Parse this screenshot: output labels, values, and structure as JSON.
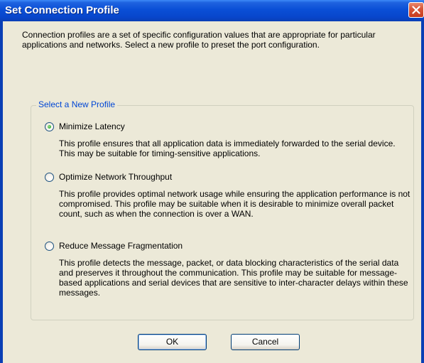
{
  "window": {
    "title": "Set Connection Profile",
    "close_icon": "close-icon"
  },
  "intro_text": "Connection profiles are a set of specific configuration values that are appropriate for particular applications and networks.  Select a new profile to preset the port configuration.",
  "group": {
    "legend": "Select a New Profile",
    "selected": "minimize-latency",
    "options": [
      {
        "id": "minimize-latency",
        "label": "Minimize Latency",
        "checked": true,
        "description": "This profile ensures that all application data is immediately forwarded to the serial device. This may be suitable for timing-sensitive applications."
      },
      {
        "id": "optimize-throughput",
        "label": "Optimize Network Throughput",
        "checked": false,
        "description": "This profile provides optimal network usage while ensuring the application performance is not compromised. This profile may be suitable when it is desirable to minimize overall packet count, such as when the connection is over a WAN."
      },
      {
        "id": "reduce-fragmentation",
        "label": "Reduce Message Fragmentation",
        "checked": false,
        "description": "This profile detects the message, packet, or data blocking characteristics of the serial data and preserves it throughout the communication. This profile may be suitable for message-based applications and serial devices that are sensitive to inter-character delays within these messages."
      }
    ]
  },
  "buttons": {
    "ok_label": "OK",
    "cancel_label": "Cancel"
  },
  "colors": {
    "title_bar": "#0a4fd6",
    "dialog_face": "#ece9d8",
    "group_legend": "#0046d5",
    "close_button": "#d9573a"
  }
}
